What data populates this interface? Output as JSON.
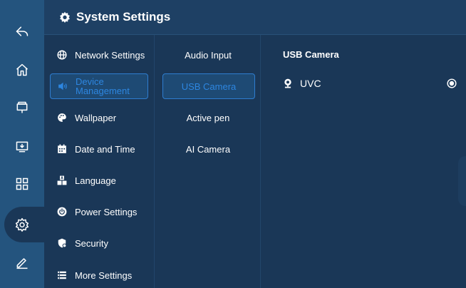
{
  "header": {
    "title": "System Settings",
    "icon": "gear-icon"
  },
  "dock": {
    "items": [
      {
        "name": "back",
        "icon": "back-arrow-icon"
      },
      {
        "name": "home",
        "icon": "home-icon"
      },
      {
        "name": "whiteboard",
        "icon": "easel-icon"
      },
      {
        "name": "screen-share",
        "icon": "monitor-download-icon"
      },
      {
        "name": "apps",
        "icon": "grid-icon"
      },
      {
        "name": "settings",
        "icon": "gear-icon",
        "active": true
      },
      {
        "name": "annotate",
        "icon": "pen-icon"
      }
    ]
  },
  "categories": [
    {
      "label": "Network Settings",
      "icon": "globe-icon"
    },
    {
      "label": "Device Management",
      "icon": "speaker-icon",
      "selected": true
    },
    {
      "label": "Wallpaper",
      "icon": "palette-icon"
    },
    {
      "label": "Date and Time",
      "icon": "calendar-icon"
    },
    {
      "label": "Language",
      "icon": "language-abc-icon"
    },
    {
      "label": "Power Settings",
      "icon": "power-icon"
    },
    {
      "label": "Security",
      "icon": "shield-icon"
    },
    {
      "label": "More Settings",
      "icon": "list-icon"
    }
  ],
  "subitems": [
    {
      "label": "Audio Input"
    },
    {
      "label": "USB Camera",
      "selected": true
    },
    {
      "label": "Active pen"
    },
    {
      "label": "AI Camera"
    }
  ],
  "detail": {
    "title": "USB Camera",
    "options": [
      {
        "label": "UVC",
        "icon": "webcam-icon",
        "selected": true
      }
    ]
  },
  "colors": {
    "background": "#1a3757",
    "dock": "#24547e",
    "accent": "#2d86e0"
  }
}
